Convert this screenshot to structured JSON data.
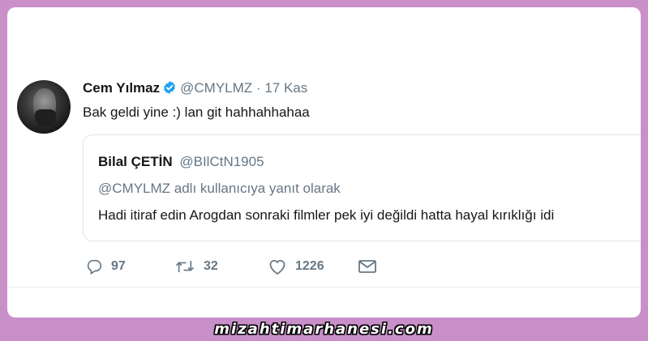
{
  "tweet": {
    "author_name": "Cem Yılmaz",
    "handle": "@CMYLMZ",
    "separator": "·",
    "date": "17 Kas",
    "verified": true,
    "verified_color": "#1da1f2",
    "text": "Bak geldi yine :) lan git hahhahhahaa",
    "avatar_icon": "avatar-photo"
  },
  "quoted_tweet": {
    "author_name": "Bilal ÇETİN",
    "handle": "@BIlCtN1905",
    "reply_context": "@CMYLMZ adlı kullanıcıya yanıt olarak",
    "text": "Hadi itiraf edin Arogdan sonraki filmler pek iyi değildi hatta hayal kırıklığı idi"
  },
  "actions": {
    "reply": {
      "icon": "reply-icon",
      "count": "97"
    },
    "retweet": {
      "icon": "retweet-icon",
      "count": "32"
    },
    "like": {
      "icon": "heart-icon",
      "count": "1226"
    },
    "dm": {
      "icon": "envelope-icon"
    }
  },
  "watermark": {
    "text": "mizahtimarhanesi.com"
  },
  "colors": {
    "frame": "#c98fc9",
    "card": "#ffffff",
    "text_primary": "#14171a",
    "text_secondary": "#657786"
  }
}
